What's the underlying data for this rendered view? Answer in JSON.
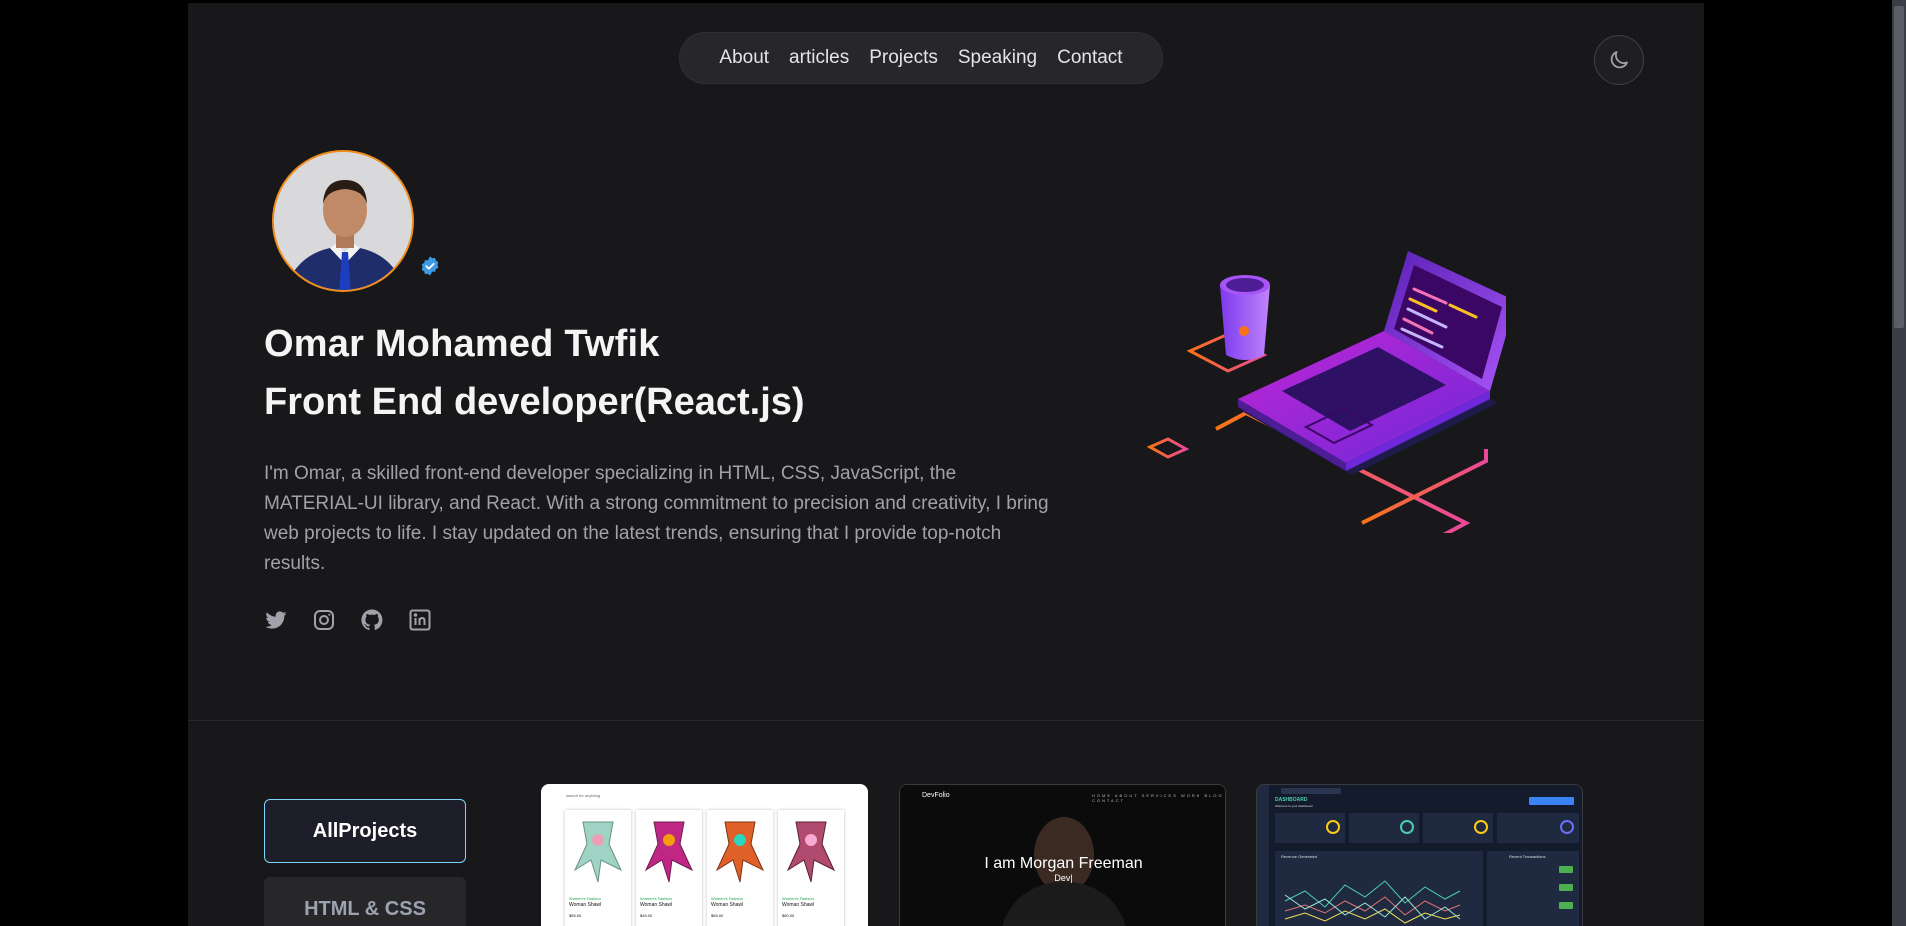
{
  "nav": {
    "items": [
      {
        "label": "About"
      },
      {
        "label": "articles"
      },
      {
        "label": "Projects"
      },
      {
        "label": "Speaking"
      },
      {
        "label": "Contact"
      }
    ]
  },
  "theme_toggle": {
    "icon": "moon-icon"
  },
  "hero": {
    "name": "Omar Mohamed Twfik",
    "role": "Front End developer(React.js)",
    "bio": "I'm Omar, a skilled front-end developer specializing in HTML, CSS, JavaScript, the MATERIAL-UI library, and React. With a strong commitment to precision and creativity, I bring web projects to life. I stay updated on the latest trends, ensuring that I provide top-notch results.",
    "socials": [
      "twitter-icon",
      "instagram-icon",
      "github-icon",
      "linkedin-icon"
    ],
    "avatar_border_color": "#f08c1a",
    "badge_color": "#3b9ae1"
  },
  "filters": [
    {
      "label": "AllProjects",
      "active": true
    },
    {
      "label": "HTML & CSS",
      "active": false
    }
  ],
  "projects": {
    "card1": {
      "tag": "search for anything",
      "items": [
        {
          "category": "Women's Fashion",
          "title": "Woman Shawl",
          "price": "$55.00"
        },
        {
          "category": "Women's Fashion",
          "title": "Woman Shawl",
          "price": "$45.00"
        },
        {
          "category": "Women's Fashion",
          "title": "Woman Shawl",
          "price": "$65.00"
        },
        {
          "category": "Women's Fashion",
          "title": "Woman Shawl",
          "price": "$60.00"
        }
      ]
    },
    "card2": {
      "brand": "DevFolio",
      "menu": "HOME ABOUT SERVICES WORK BLOG CONTACT",
      "headline": "I am Morgan Freeman",
      "sub": "Dev|"
    },
    "card3": {
      "title": "DASHBOARD",
      "subtitle": "Welcome to your dashboard",
      "chart_title": "Revenue Generated",
      "tx_title": "Recent Transactions"
    }
  },
  "colors": {
    "accent": "#7dd3fc",
    "page_bg": "#18181b",
    "nav_bg": "#27272a"
  }
}
